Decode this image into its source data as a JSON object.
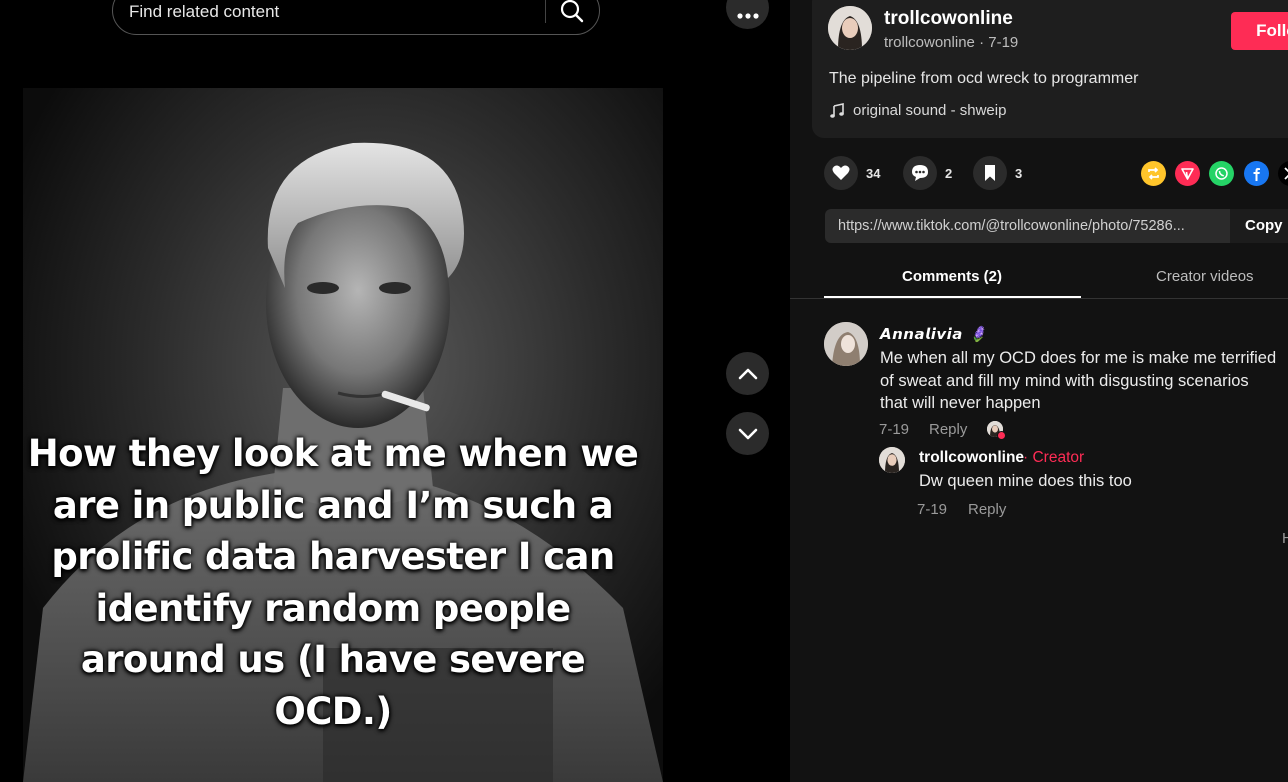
{
  "search": {
    "placeholder": "Find related content"
  },
  "media": {
    "caption": "How they look at me when we are in public and I’m such a prolific data harvester I can identify random people around us (I have severe OCD.)"
  },
  "post": {
    "author_name": "trollcowonline",
    "author_handle": "trollcowonline",
    "date": "7-19",
    "follow_label": "Follow",
    "description": "The pipeline from ocd wreck to programmer",
    "music": "original sound - shweip"
  },
  "actions": {
    "likes": "34",
    "comments": "2",
    "saves": "3"
  },
  "share": {
    "icons": [
      "repost-icon",
      "send-icon",
      "whatsapp-icon",
      "facebook-icon",
      "x-icon"
    ],
    "colors": {
      "repost": "#ffc52b",
      "send": "#fe2c55",
      "whatsapp": "#25d366",
      "facebook": "#1877f2"
    }
  },
  "link": {
    "url": "https://www.tiktok.com/@trollcowonline/photo/75286...",
    "copy_label": "Copy link"
  },
  "tabs": {
    "comments": "Comments (2)",
    "creator_videos": "Creator videos"
  },
  "comments": [
    {
      "name": "𝘼𝙣𝙣𝙖𝙡𝙞𝙫𝙞𝙖 🪻",
      "text": "Me when all my OCD does for me is make me terrified of sweat and fill my mind with disgusting scenarios that will never happen",
      "date": "7-19",
      "reply_label": "Reply"
    },
    {
      "name": "trollcowonline",
      "badge": " · Creator",
      "text": "Dw queen mine does this too",
      "date": "7-19",
      "reply_label": "Reply"
    }
  ],
  "edge_text": "H",
  "theme": {
    "accent": "#fe2c55",
    "panel_bg": "#121212",
    "card_bg": "#1e1e1e"
  }
}
